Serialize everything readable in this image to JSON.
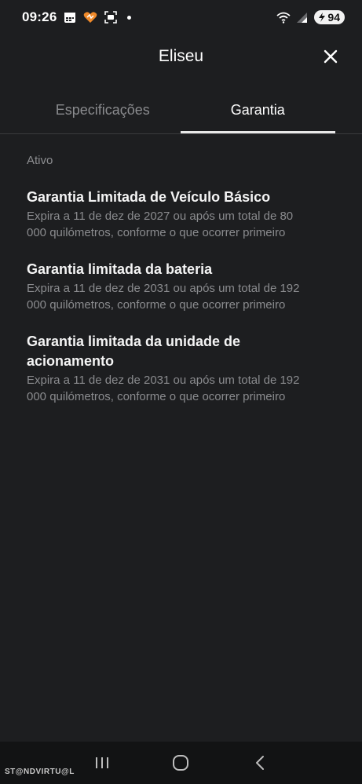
{
  "status_bar": {
    "time": "09:26",
    "battery": "94",
    "icons": [
      "calendar-icon",
      "heart-app-icon",
      "screenshot-icon",
      "notification-dot",
      "wifi-icon",
      "signal-icon",
      "battery-icon"
    ]
  },
  "header": {
    "title": "Eliseu",
    "close_icon": "close-icon"
  },
  "tabs": [
    {
      "label": "Especificações",
      "active": false
    },
    {
      "label": "Garantia",
      "active": true
    }
  ],
  "section": {
    "label": "Ativo"
  },
  "warranties": [
    {
      "title": "Garantia Limitada de Veículo Básico",
      "description": "Expira a 11 de dez de 2027 ou após um total de 80 000 quilómetros, conforme o que ocorrer primeiro"
    },
    {
      "title": "Garantia limitada da bateria",
      "description": "Expira a 11 de dez de 2031 ou após um total de 192 000 quilómetros, conforme o que ocorrer primeiro"
    },
    {
      "title": "Garantia limitada da unidade de acionamento",
      "description": "Expira a 11 de dez de 2031 ou após um total de 192 000 quilómetros, conforme o que ocorrer primeiro"
    }
  ],
  "nav_bar": {
    "buttons": [
      "recent-apps-icon",
      "home-icon",
      "back-icon"
    ]
  },
  "watermark": "ST@NDVIRTU@L",
  "colors": {
    "background": "#1d1e20",
    "text_primary": "#ffffff",
    "text_secondary": "#8a8b8e",
    "nav_background": "#121314"
  }
}
